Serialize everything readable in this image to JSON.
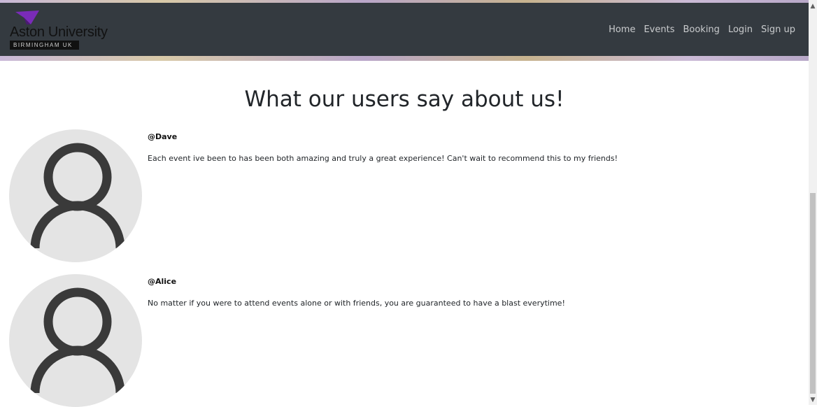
{
  "brand": {
    "name": "Aston University",
    "tagline": "BIRMINGHAM UK",
    "accent_color": "#7a2bb8"
  },
  "nav": {
    "items": [
      {
        "label": "Home"
      },
      {
        "label": "Events"
      },
      {
        "label": "Booking"
      },
      {
        "label": "Login"
      },
      {
        "label": "Sign up"
      }
    ]
  },
  "testimonials": {
    "heading": "What our users say about us!",
    "reviews": [
      {
        "username": "@Dave",
        "text": "Each event ive been to has been both amazing and truly a great experience! Can't wait to recommend this to my friends!",
        "avatar_icon": "user-icon"
      },
      {
        "username": "@Alice",
        "text": "No matter if you were to attend events alone or with friends, you are guaranteed to have a blast everytime!",
        "avatar_icon": "user-icon"
      }
    ]
  },
  "colors": {
    "navbar": "#343a40",
    "nav_link": "#c9cbcd",
    "avatar_bg": "#e4e4e4",
    "avatar_figure": "#3a3a3a"
  }
}
